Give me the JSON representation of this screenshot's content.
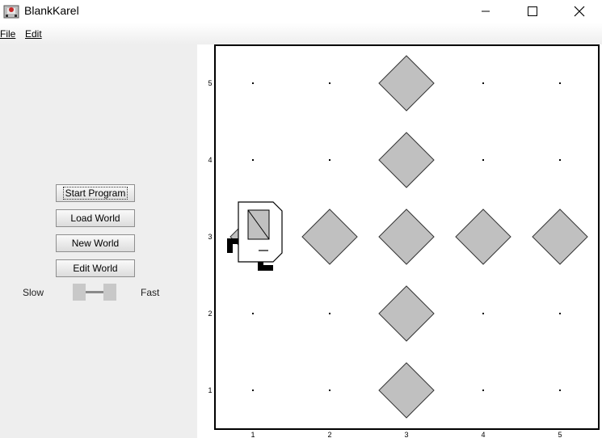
{
  "window": {
    "title": "BlankKarel",
    "controls": [
      "minimize",
      "maximize",
      "close"
    ]
  },
  "menu": {
    "items": [
      {
        "label": "File"
      },
      {
        "label": "Edit"
      }
    ]
  },
  "controls": {
    "start_program": "Start Program",
    "load_world": "Load World",
    "new_world": "New World",
    "edit_world": "Edit World",
    "speed_slow": "Slow",
    "speed_fast": "Fast",
    "speed_level": 0.5
  },
  "world": {
    "columns": 5,
    "rows": 5,
    "column_labels": [
      "1",
      "2",
      "3",
      "4",
      "5"
    ],
    "row_labels": [
      "1",
      "2",
      "3",
      "4",
      "5"
    ],
    "beepers": [
      {
        "col": 3,
        "row": 5
      },
      {
        "col": 3,
        "row": 4
      },
      {
        "col": 2,
        "row": 3
      },
      {
        "col": 3,
        "row": 3
      },
      {
        "col": 4,
        "row": 3
      },
      {
        "col": 5,
        "row": 3
      },
      {
        "col": 3,
        "row": 2
      },
      {
        "col": 3,
        "row": 1
      }
    ],
    "karel": {
      "col": 1,
      "row": 3,
      "facing": "east"
    },
    "beeper_color": "#c0c0c0"
  }
}
